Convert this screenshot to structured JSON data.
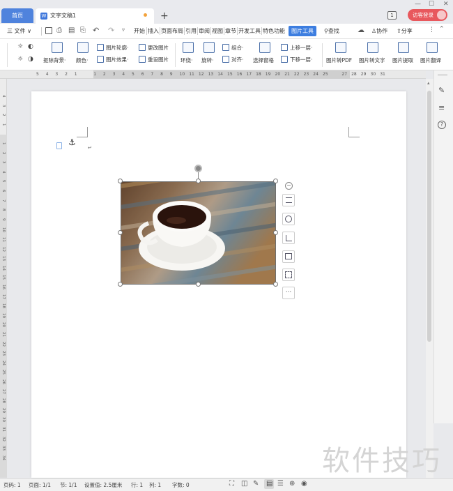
{
  "tabs": {
    "home": "首页",
    "doc": "文字文稿1",
    "new": "+"
  },
  "window": {
    "min": "—",
    "max": "☐",
    "close": "✕",
    "badge": "1",
    "login": "访客登录"
  },
  "menu": {
    "file": "三 文件 ∨",
    "items": [
      "开始",
      "插入",
      "页面布局",
      "引用",
      "审阅",
      "视图",
      "章节",
      "开发工具",
      "特色功能"
    ],
    "active": "图片工具",
    "search": "查找",
    "collab": "协作",
    "share": "分享"
  },
  "ribbon": {
    "remove_bg": "抠除背景·",
    "color": "颜色·",
    "outline": "图片轮廓·",
    "effect": "图片效果·",
    "change": "更改图片",
    "reset": "重设图片",
    "wrap": "环绕·",
    "rotate": "旋转·",
    "group": "组合·",
    "align": "对齐·",
    "select_pane": "选择窗格",
    "bring_up": "上移一层·",
    "send_down": "下移一层·",
    "to_pdf": "图片转PDF",
    "to_text": "图片转文字",
    "extract": "图片提取",
    "translate": "图片翻译"
  },
  "hruler": [
    "5",
    "4",
    "3",
    "2",
    "1",
    "",
    "1",
    "2",
    "3",
    "4",
    "5",
    "6",
    "7",
    "8",
    "9",
    "10",
    "11",
    "12",
    "13",
    "14",
    "15",
    "16",
    "17",
    "18",
    "19",
    "20",
    "21",
    "22",
    "23",
    "24",
    "25",
    "",
    "27",
    "28",
    "29",
    "30",
    "31"
  ],
  "vruler": [
    "4",
    "3",
    "2",
    "1",
    "",
    "1",
    "2",
    "3",
    "4",
    "5",
    "6",
    "7",
    "8",
    "9",
    "10",
    "11",
    "12",
    "13",
    "14",
    "15",
    "16",
    "17",
    "18",
    "19",
    "20",
    "21",
    "22",
    "23",
    "24",
    "25",
    "26",
    "27",
    "28",
    "29",
    "30",
    "31",
    "32",
    "33",
    "34"
  ],
  "status": {
    "page_code": "页码: 1",
    "pages": "页面: 1/1",
    "section": "节: 1/1",
    "setting": "设置值: 2.5厘米",
    "row": "行: 1",
    "col": "列: 1",
    "words": "字数: 0"
  },
  "watermark": "软件技巧",
  "colors": {
    "accent": "#3d7ee0",
    "login": "#e8585d"
  }
}
